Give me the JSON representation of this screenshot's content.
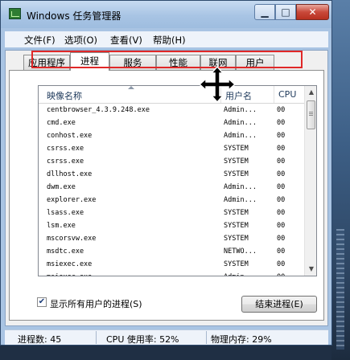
{
  "window": {
    "title": "Windows 任务管理器"
  },
  "window_controls": {
    "minimize": "▁",
    "maximize": "□",
    "close": "✕"
  },
  "menu": [
    {
      "label": "文件(F)"
    },
    {
      "label": "选项(O)"
    },
    {
      "label": "查看(V)"
    },
    {
      "label": "帮助(H)"
    }
  ],
  "tabs": [
    {
      "label": "应用程序",
      "active": false
    },
    {
      "label": "进程",
      "active": true
    },
    {
      "label": "服务",
      "active": false
    },
    {
      "label": "性能",
      "active": false
    },
    {
      "label": "联网",
      "active": false
    },
    {
      "label": "用户",
      "active": false
    }
  ],
  "process_table": {
    "columns": [
      "映像名称",
      "用户名",
      "CPU"
    ],
    "rows": [
      {
        "name": "centbrowser_4.3.9.248.exe",
        "user": "Admin...",
        "cpu": "00"
      },
      {
        "name": "cmd.exe",
        "user": "Admin...",
        "cpu": "00"
      },
      {
        "name": "conhost.exe",
        "user": "Admin...",
        "cpu": "00"
      },
      {
        "name": "csrss.exe",
        "user": "SYSTEM",
        "cpu": "00"
      },
      {
        "name": "csrss.exe",
        "user": "SYSTEM",
        "cpu": "00"
      },
      {
        "name": "dllhost.exe",
        "user": "SYSTEM",
        "cpu": "00"
      },
      {
        "name": "dwm.exe",
        "user": "Admin...",
        "cpu": "00"
      },
      {
        "name": "explorer.exe",
        "user": "Admin...",
        "cpu": "00"
      },
      {
        "name": "lsass.exe",
        "user": "SYSTEM",
        "cpu": "00"
      },
      {
        "name": "lsm.exe",
        "user": "SYSTEM",
        "cpu": "00"
      },
      {
        "name": "mscorsvw.exe",
        "user": "SYSTEM",
        "cpu": "00"
      },
      {
        "name": "msdtc.exe",
        "user": "NETWO...",
        "cpu": "00"
      },
      {
        "name": "msiexec.exe",
        "user": "SYSTEM",
        "cpu": "00"
      },
      {
        "name": "msiexec.exe",
        "user": "Admin...",
        "cpu": "00"
      }
    ],
    "selected_row": 0
  },
  "show_all_users": {
    "label": "显示所有用户的进程(S)",
    "checked": true
  },
  "end_process_button": {
    "label": "结束进程(E)"
  },
  "status": {
    "processes": "进程数: 45",
    "cpu": "CPU 使用率: 52%",
    "memory": "物理内存: 29%"
  },
  "icons": [
    "app-icon",
    "move-cursor-icon",
    "checkmark-icon",
    "scroll-up-icon",
    "scroll-down-icon"
  ],
  "colors": {
    "highlight_border": "#e02828",
    "title_bar": "#a9c4e3"
  }
}
